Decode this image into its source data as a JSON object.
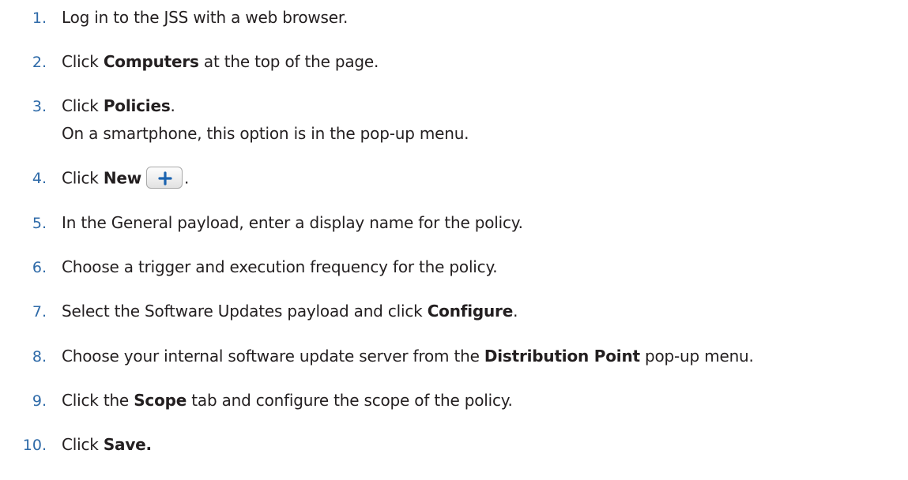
{
  "steps": [
    {
      "num": "1.",
      "parts": [
        {
          "t": "Log in to the JSS with a web browser."
        }
      ]
    },
    {
      "num": "2.",
      "parts": [
        {
          "t": "Click "
        },
        {
          "t": "Computers",
          "b": true
        },
        {
          "t": " at the top of the page."
        }
      ]
    },
    {
      "num": "3.",
      "parts": [
        {
          "t": "Click "
        },
        {
          "t": "Policies",
          "b": true
        },
        {
          "t": "."
        }
      ]
    },
    {
      "num": "",
      "note": "On a smartphone, this option is in the pop-up menu."
    },
    {
      "num": "4.",
      "parts": [
        {
          "t": "Click "
        },
        {
          "t": "New",
          "b": true
        },
        {
          "icon": "plus-icon"
        },
        {
          "t": "."
        }
      ]
    },
    {
      "num": "5.",
      "parts": [
        {
          "t": "In the General payload, enter a display name for the policy."
        }
      ]
    },
    {
      "num": "6.",
      "parts": [
        {
          "t": "Choose a trigger and execution frequency for the policy."
        }
      ]
    },
    {
      "num": "7.",
      "parts": [
        {
          "t": "Select the Software Updates payload and click "
        },
        {
          "t": "Configure",
          "b": true
        },
        {
          "t": "."
        }
      ]
    },
    {
      "num": "8.",
      "parts": [
        {
          "t": "Choose your internal software update server from the "
        },
        {
          "t": "Distribution Point",
          "b": true
        },
        {
          "t": " pop-up menu."
        }
      ]
    },
    {
      "num": "9.",
      "parts": [
        {
          "t": "Click the "
        },
        {
          "t": "Scope",
          "b": true
        },
        {
          "t": " tab and configure the scope of the policy."
        }
      ]
    },
    {
      "num": "10.",
      "parts": [
        {
          "t": "Click "
        },
        {
          "t": "Save.",
          "b": true
        }
      ]
    }
  ],
  "colors": {
    "number": "#2e6aa8",
    "text": "#231f20",
    "plus_icon": "#1b63b0"
  }
}
